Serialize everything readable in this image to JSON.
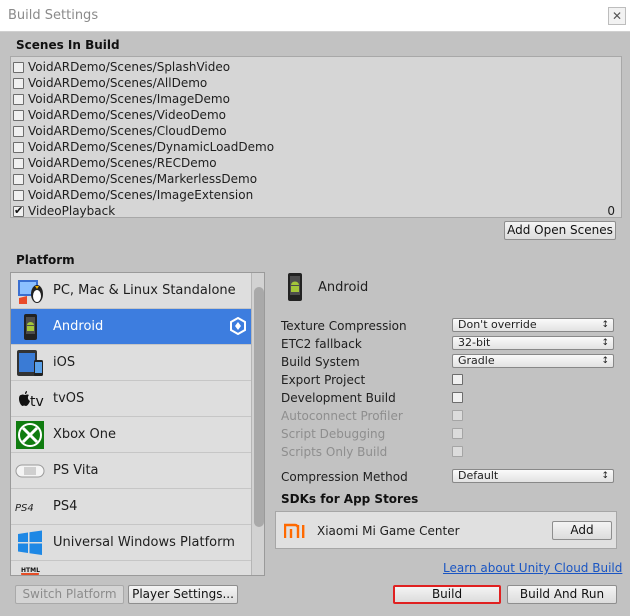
{
  "window": {
    "title": "Build Settings",
    "close_glyph": "✕"
  },
  "scenes": {
    "header": "Scenes In Build",
    "items": [
      {
        "label": "VoidARDemo/Scenes/SplashVideo",
        "checked": false,
        "index": ""
      },
      {
        "label": "VoidARDemo/Scenes/AllDemo",
        "checked": false,
        "index": ""
      },
      {
        "label": "VoidARDemo/Scenes/ImageDemo",
        "checked": false,
        "index": ""
      },
      {
        "label": "VoidARDemo/Scenes/VideoDemo",
        "checked": false,
        "index": ""
      },
      {
        "label": "VoidARDemo/Scenes/CloudDemo",
        "checked": false,
        "index": ""
      },
      {
        "label": "VoidARDemo/Scenes/DynamicLoadDemo",
        "checked": false,
        "index": ""
      },
      {
        "label": "VoidARDemo/Scenes/RECDemo",
        "checked": false,
        "index": ""
      },
      {
        "label": "VoidARDemo/Scenes/MarkerlessDemo",
        "checked": false,
        "index": ""
      },
      {
        "label": "VoidARDemo/Scenes/ImageExtension",
        "checked": false,
        "index": ""
      },
      {
        "label": "VideoPlayback",
        "checked": true,
        "index": "0"
      }
    ],
    "add_open_scenes": "Add Open Scenes"
  },
  "platform": {
    "header": "Platform",
    "items": [
      {
        "label": "PC, Mac & Linux Standalone",
        "icon": "standalone-icon",
        "selected": false
      },
      {
        "label": "Android",
        "icon": "android-icon",
        "selected": true
      },
      {
        "label": "iOS",
        "icon": "ios-icon",
        "selected": false
      },
      {
        "label": "tvOS",
        "icon": "tvos-icon",
        "selected": false
      },
      {
        "label": "Xbox One",
        "icon": "xbox-icon",
        "selected": false
      },
      {
        "label": "PS Vita",
        "icon": "psvita-icon",
        "selected": false
      },
      {
        "label": "PS4",
        "icon": "ps4-icon",
        "selected": false
      },
      {
        "label": "Universal Windows Platform",
        "icon": "windows-icon",
        "selected": false
      },
      {
        "label": "",
        "icon": "html5-icon",
        "selected": false
      }
    ],
    "current_target_icon": "unity-logo-icon",
    "tvos_icon_text": "tv",
    "ps4_icon_text": "PS4",
    "html_icon_text": "HTML"
  },
  "settings": {
    "platform_name": "Android",
    "texture_compression": {
      "label": "Texture Compression",
      "value": "Don't override"
    },
    "etc2_fallback": {
      "label": "ETC2 fallback",
      "value": "32-bit"
    },
    "build_system": {
      "label": "Build System",
      "value": "Gradle"
    },
    "export_project": {
      "label": "Export Project",
      "checked": false
    },
    "development_build": {
      "label": "Development Build",
      "checked": false
    },
    "autoconnect_profiler": {
      "label": "Autoconnect Profiler",
      "checked": false
    },
    "script_debugging": {
      "label": "Script Debugging",
      "checked": false
    },
    "scripts_only_build": {
      "label": "Scripts Only Build",
      "checked": false
    },
    "compression_method": {
      "label": "Compression Method",
      "value": "Default"
    }
  },
  "sdks": {
    "header": "SDKs for App Stores",
    "items": [
      {
        "logo": "mi",
        "label": "Xiaomi Mi Game Center",
        "button": "Add"
      }
    ]
  },
  "footer": {
    "cloud_link": "Learn about Unity Cloud Build",
    "switch_platform": "Switch Platform",
    "player_settings": "Player Settings...",
    "build": "Build",
    "build_and_run": "Build And Run"
  },
  "colors": {
    "selection": "#3d7ddf",
    "highlight_border": "#e02020",
    "mi_orange": "#ff6900",
    "link": "#1a55c2"
  }
}
